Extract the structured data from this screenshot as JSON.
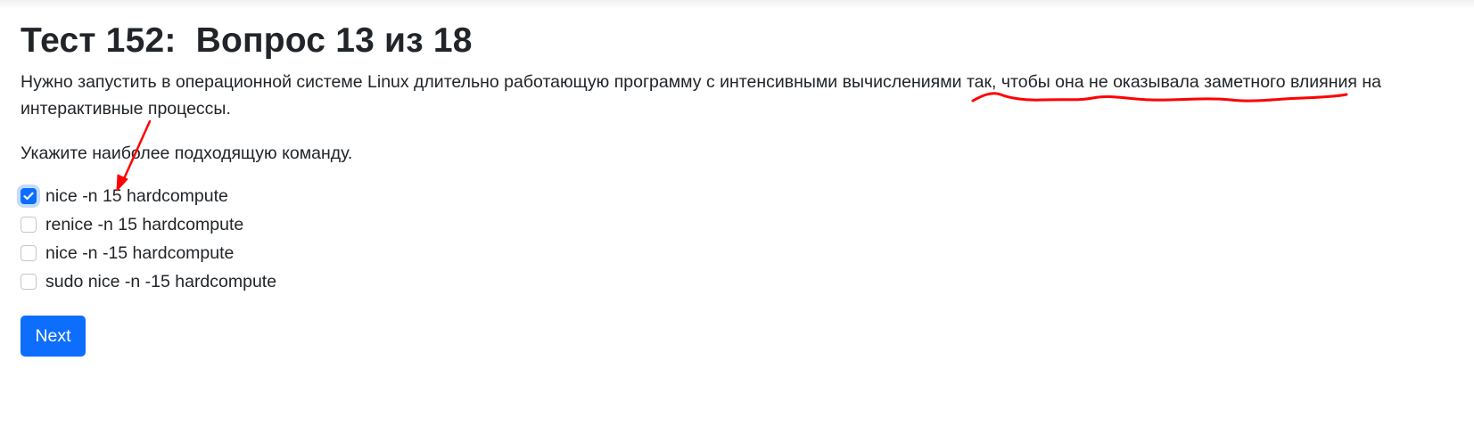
{
  "page": {
    "title": "Тест 152:  Вопрос 13 из 18",
    "question_text": "Нужно запустить в операционной системе Linux длительно работающую программу с интенсивными вычислениями так, чтобы она не оказывала заметного влияния на интерактивные процессы.",
    "instruction": "Укажите наиболее подходящую команду."
  },
  "options": [
    {
      "label": "nice -n 15 hardcompute",
      "checked": true
    },
    {
      "label": "renice -n 15 hardcompute",
      "checked": false
    },
    {
      "label": "nice -n -15 hardcompute",
      "checked": false
    },
    {
      "label": "sudo nice -n -15 hardcompute",
      "checked": false
    }
  ],
  "buttons": {
    "next_label": "Next"
  },
  "colors": {
    "primary": "#0d6efd",
    "annotation": "#ff0000",
    "text": "#212529"
  }
}
